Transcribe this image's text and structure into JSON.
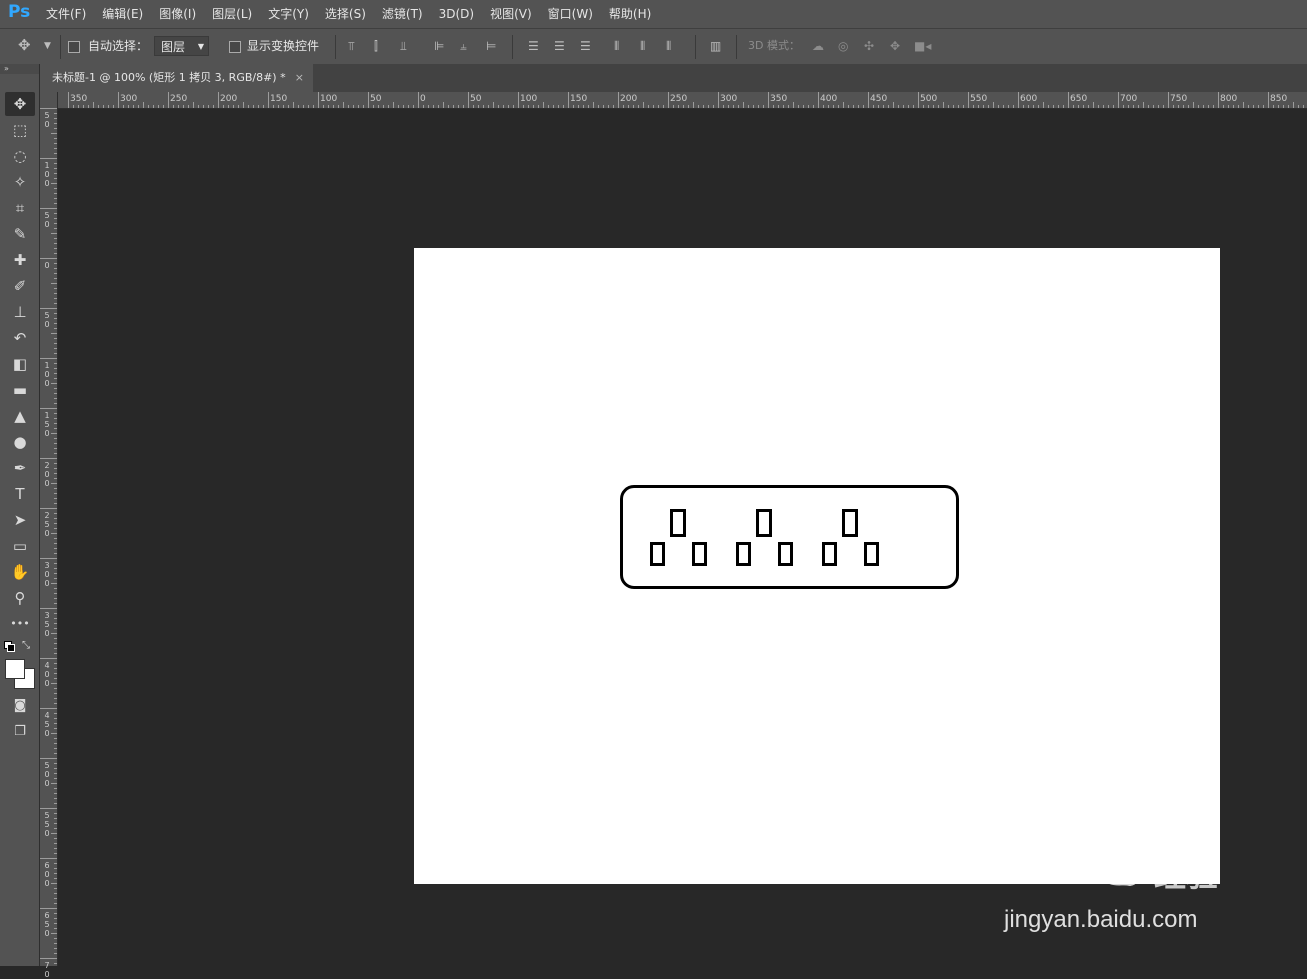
{
  "app": {
    "logo": "Ps"
  },
  "menu": [
    "文件(F)",
    "编辑(E)",
    "图像(I)",
    "图层(L)",
    "文字(Y)",
    "选择(S)",
    "滤镜(T)",
    "3D(D)",
    "视图(V)",
    "窗口(W)",
    "帮助(H)"
  ],
  "options": {
    "auto_select_label": "自动选择：",
    "auto_select_value": "图层",
    "show_transform_label": "显示变换控件",
    "mode_3d_label": "3D 模式："
  },
  "document_tab": {
    "title": "未标题-1 @ 100% (矩形 1 拷贝 3, RGB/8#) *",
    "close": "×"
  },
  "ruler_top_labels": [
    "350",
    "300",
    "250",
    "200",
    "150",
    "100",
    "50",
    "0",
    "50",
    "100",
    "150",
    "200",
    "250",
    "300",
    "350",
    "400",
    "450",
    "500",
    "550",
    "600",
    "650",
    "700",
    "750",
    "800",
    "850"
  ],
  "ruler_left_labels": [
    "5\n0",
    "1\n0\n0",
    "5\n0",
    "0",
    "5\n0",
    "1\n0\n0",
    "1\n5\n0",
    "2\n0\n0",
    "2\n5\n0",
    "3\n0\n0",
    "3\n5\n0",
    "4\n0\n0",
    "4\n5\n0",
    "5\n0\n0",
    "5\n5\n0",
    "6\n0\n0",
    "6\n5\n0",
    "7\n0"
  ],
  "tools": [
    {
      "name": "move-tool",
      "glyph": "✥"
    },
    {
      "name": "marquee-tool",
      "glyph": "⬚"
    },
    {
      "name": "lasso-tool",
      "glyph": "◌"
    },
    {
      "name": "magic-wand-tool",
      "glyph": "✧"
    },
    {
      "name": "crop-tool",
      "glyph": "⌗"
    },
    {
      "name": "eyedropper-tool",
      "glyph": "✎"
    },
    {
      "name": "healing-brush-tool",
      "glyph": "✚"
    },
    {
      "name": "brush-tool",
      "glyph": "✐"
    },
    {
      "name": "stamp-tool",
      "glyph": "⊥"
    },
    {
      "name": "history-brush-tool",
      "glyph": "↶"
    },
    {
      "name": "eraser-tool",
      "glyph": "◧"
    },
    {
      "name": "gradient-tool",
      "glyph": "▬"
    },
    {
      "name": "blur-tool",
      "glyph": "▲"
    },
    {
      "name": "dodge-tool",
      "glyph": "●"
    },
    {
      "name": "pen-tool",
      "glyph": "✒"
    },
    {
      "name": "type-tool",
      "glyph": "T"
    },
    {
      "name": "path-selection-tool",
      "glyph": "➤"
    },
    {
      "name": "rectangle-tool",
      "glyph": "▭"
    },
    {
      "name": "hand-tool",
      "glyph": "✋"
    },
    {
      "name": "zoom-tool",
      "glyph": "⚲"
    },
    {
      "name": "more-tools",
      "glyph": "•••"
    }
  ],
  "watermark": {
    "brand": "Bai du",
    "cn": "经验",
    "url": "jingyan.baidu.com"
  },
  "colors": {
    "menubar": "#535353",
    "workspace": "#282828",
    "canvas": "#ffffff",
    "ps_blue": "#31a8ff"
  }
}
